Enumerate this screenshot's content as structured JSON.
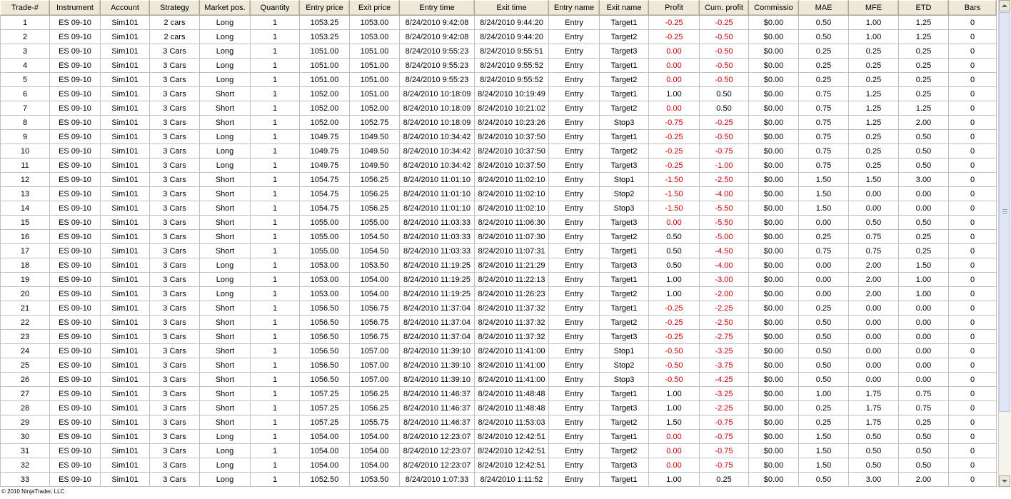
{
  "columns": [
    "Trade-#",
    "Instrument",
    "Account",
    "Strategy",
    "Market pos.",
    "Quantity",
    "Entry price",
    "Exit price",
    "Entry time",
    "Exit time",
    "Entry name",
    "Exit name",
    "Profit",
    "Cum. profit",
    "Commissio",
    "MAE",
    "MFE",
    "ETD",
    "Bars"
  ],
  "colors": {
    "negative": "#cc0000",
    "header_bg": "#ece9d8"
  },
  "rows": [
    [
      "1",
      "ES 09-10",
      "Sim101",
      "2 cars",
      "Long",
      "1",
      "1053.25",
      "1053.00",
      "8/24/2010 9:42:08",
      "8/24/2010 9:44:20",
      "Entry",
      "Target1",
      "-0.25",
      "-0.25",
      "$0.00",
      "0.50",
      "1.00",
      "1.25",
      "0"
    ],
    [
      "2",
      "ES 09-10",
      "Sim101",
      "2 cars",
      "Long",
      "1",
      "1053.25",
      "1053.00",
      "8/24/2010 9:42:08",
      "8/24/2010 9:44:20",
      "Entry",
      "Target2",
      "-0.25",
      "-0.50",
      "$0.00",
      "0.50",
      "1.00",
      "1.25",
      "0"
    ],
    [
      "3",
      "ES 09-10",
      "Sim101",
      "3 Cars",
      "Long",
      "1",
      "1051.00",
      "1051.00",
      "8/24/2010 9:55:23",
      "8/24/2010 9:55:51",
      "Entry",
      "Target3",
      "0.00",
      "-0.50",
      "$0.00",
      "0.25",
      "0.25",
      "0.25",
      "0"
    ],
    [
      "4",
      "ES 09-10",
      "Sim101",
      "3 Cars",
      "Long",
      "1",
      "1051.00",
      "1051.00",
      "8/24/2010 9:55:23",
      "8/24/2010 9:55:52",
      "Entry",
      "Target1",
      "0.00",
      "-0.50",
      "$0.00",
      "0.25",
      "0.25",
      "0.25",
      "0"
    ],
    [
      "5",
      "ES 09-10",
      "Sim101",
      "3 Cars",
      "Long",
      "1",
      "1051.00",
      "1051.00",
      "8/24/2010 9:55:23",
      "8/24/2010 9:55:52",
      "Entry",
      "Target2",
      "0.00",
      "-0.50",
      "$0.00",
      "0.25",
      "0.25",
      "0.25",
      "0"
    ],
    [
      "6",
      "ES 09-10",
      "Sim101",
      "3 Cars",
      "Short",
      "1",
      "1052.00",
      "1051.00",
      "8/24/2010 10:18:09",
      "8/24/2010 10:19:49",
      "Entry",
      "Target1",
      "1.00",
      "0.50",
      "$0.00",
      "0.75",
      "1.25",
      "0.25",
      "0"
    ],
    [
      "7",
      "ES 09-10",
      "Sim101",
      "3 Cars",
      "Short",
      "1",
      "1052.00",
      "1052.00",
      "8/24/2010 10:18:09",
      "8/24/2010 10:21:02",
      "Entry",
      "Target2",
      "0.00",
      "0.50",
      "$0.00",
      "0.75",
      "1.25",
      "1.25",
      "0"
    ],
    [
      "8",
      "ES 09-10",
      "Sim101",
      "3 Cars",
      "Short",
      "1",
      "1052.00",
      "1052.75",
      "8/24/2010 10:18:09",
      "8/24/2010 10:23:26",
      "Entry",
      "Stop3",
      "-0.75",
      "-0.25",
      "$0.00",
      "0.75",
      "1.25",
      "2.00",
      "0"
    ],
    [
      "9",
      "ES 09-10",
      "Sim101",
      "3 Cars",
      "Long",
      "1",
      "1049.75",
      "1049.50",
      "8/24/2010 10:34:42",
      "8/24/2010 10:37:50",
      "Entry",
      "Target1",
      "-0.25",
      "-0.50",
      "$0.00",
      "0.75",
      "0.25",
      "0.50",
      "0"
    ],
    [
      "10",
      "ES 09-10",
      "Sim101",
      "3 Cars",
      "Long",
      "1",
      "1049.75",
      "1049.50",
      "8/24/2010 10:34:42",
      "8/24/2010 10:37:50",
      "Entry",
      "Target2",
      "-0.25",
      "-0.75",
      "$0.00",
      "0.75",
      "0.25",
      "0.50",
      "0"
    ],
    [
      "11",
      "ES 09-10",
      "Sim101",
      "3 Cars",
      "Long",
      "1",
      "1049.75",
      "1049.50",
      "8/24/2010 10:34:42",
      "8/24/2010 10:37:50",
      "Entry",
      "Target3",
      "-0.25",
      "-1.00",
      "$0.00",
      "0.75",
      "0.25",
      "0.50",
      "0"
    ],
    [
      "12",
      "ES 09-10",
      "Sim101",
      "3 Cars",
      "Short",
      "1",
      "1054.75",
      "1056.25",
      "8/24/2010 11:01:10",
      "8/24/2010 11:02:10",
      "Entry",
      "Stop1",
      "-1.50",
      "-2.50",
      "$0.00",
      "1.50",
      "1.50",
      "3.00",
      "0"
    ],
    [
      "13",
      "ES 09-10",
      "Sim101",
      "3 Cars",
      "Short",
      "1",
      "1054.75",
      "1056.25",
      "8/24/2010 11:01:10",
      "8/24/2010 11:02:10",
      "Entry",
      "Stop2",
      "-1.50",
      "-4.00",
      "$0.00",
      "1.50",
      "0.00",
      "0.00",
      "0"
    ],
    [
      "14",
      "ES 09-10",
      "Sim101",
      "3 Cars",
      "Short",
      "1",
      "1054.75",
      "1056.25",
      "8/24/2010 11:01:10",
      "8/24/2010 11:02:10",
      "Entry",
      "Stop3",
      "-1.50",
      "-5.50",
      "$0.00",
      "1.50",
      "0.00",
      "0.00",
      "0"
    ],
    [
      "15",
      "ES 09-10",
      "Sim101",
      "3 Cars",
      "Short",
      "1",
      "1055.00",
      "1055.00",
      "8/24/2010 11:03:33",
      "8/24/2010 11:06:30",
      "Entry",
      "Target3",
      "0.00",
      "-5.50",
      "$0.00",
      "0.00",
      "0.50",
      "0.50",
      "0"
    ],
    [
      "16",
      "ES 09-10",
      "Sim101",
      "3 Cars",
      "Short",
      "1",
      "1055.00",
      "1054.50",
      "8/24/2010 11:03:33",
      "8/24/2010 11:07:30",
      "Entry",
      "Target2",
      "0.50",
      "-5.00",
      "$0.00",
      "0.25",
      "0.75",
      "0.25",
      "0"
    ],
    [
      "17",
      "ES 09-10",
      "Sim101",
      "3 Cars",
      "Short",
      "1",
      "1055.00",
      "1054.50",
      "8/24/2010 11:03:33",
      "8/24/2010 11:07:31",
      "Entry",
      "Target1",
      "0.50",
      "-4.50",
      "$0.00",
      "0.75",
      "0.75",
      "0.25",
      "0"
    ],
    [
      "18",
      "ES 09-10",
      "Sim101",
      "3 Cars",
      "Long",
      "1",
      "1053.00",
      "1053.50",
      "8/24/2010 11:19:25",
      "8/24/2010 11:21:29",
      "Entry",
      "Target3",
      "0.50",
      "-4.00",
      "$0.00",
      "0.00",
      "2.00",
      "1.50",
      "0"
    ],
    [
      "19",
      "ES 09-10",
      "Sim101",
      "3 Cars",
      "Long",
      "1",
      "1053.00",
      "1054.00",
      "8/24/2010 11:19:25",
      "8/24/2010 11:22:13",
      "Entry",
      "Target1",
      "1.00",
      "-3.00",
      "$0.00",
      "0.00",
      "2.00",
      "1.00",
      "0"
    ],
    [
      "20",
      "ES 09-10",
      "Sim101",
      "3 Cars",
      "Long",
      "1",
      "1053.00",
      "1054.00",
      "8/24/2010 11:19:25",
      "8/24/2010 11:26:23",
      "Entry",
      "Target2",
      "1.00",
      "-2.00",
      "$0.00",
      "0.00",
      "2.00",
      "1.00",
      "0"
    ],
    [
      "21",
      "ES 09-10",
      "Sim101",
      "3 Cars",
      "Short",
      "1",
      "1056.50",
      "1056.75",
      "8/24/2010 11:37:04",
      "8/24/2010 11:37:32",
      "Entry",
      "Target1",
      "-0.25",
      "-2.25",
      "$0.00",
      "0.25",
      "0.00",
      "0.00",
      "0"
    ],
    [
      "22",
      "ES 09-10",
      "Sim101",
      "3 Cars",
      "Short",
      "1",
      "1056.50",
      "1056.75",
      "8/24/2010 11:37:04",
      "8/24/2010 11:37:32",
      "Entry",
      "Target2",
      "-0.25",
      "-2.50",
      "$0.00",
      "0.50",
      "0.00",
      "0.00",
      "0"
    ],
    [
      "23",
      "ES 09-10",
      "Sim101",
      "3 Cars",
      "Short",
      "1",
      "1056.50",
      "1056.75",
      "8/24/2010 11:37:04",
      "8/24/2010 11:37:32",
      "Entry",
      "Target3",
      "-0.25",
      "-2.75",
      "$0.00",
      "0.50",
      "0.00",
      "0.00",
      "0"
    ],
    [
      "24",
      "ES 09-10",
      "Sim101",
      "3 Cars",
      "Short",
      "1",
      "1056.50",
      "1057.00",
      "8/24/2010 11:39:10",
      "8/24/2010 11:41:00",
      "Entry",
      "Stop1",
      "-0.50",
      "-3.25",
      "$0.00",
      "0.50",
      "0.00",
      "0.00",
      "0"
    ],
    [
      "25",
      "ES 09-10",
      "Sim101",
      "3 Cars",
      "Short",
      "1",
      "1056.50",
      "1057.00",
      "8/24/2010 11:39:10",
      "8/24/2010 11:41:00",
      "Entry",
      "Stop2",
      "-0.50",
      "-3.75",
      "$0.00",
      "0.50",
      "0.00",
      "0.00",
      "0"
    ],
    [
      "26",
      "ES 09-10",
      "Sim101",
      "3 Cars",
      "Short",
      "1",
      "1056.50",
      "1057.00",
      "8/24/2010 11:39:10",
      "8/24/2010 11:41:00",
      "Entry",
      "Stop3",
      "-0.50",
      "-4.25",
      "$0.00",
      "0.50",
      "0.00",
      "0.00",
      "0"
    ],
    [
      "27",
      "ES 09-10",
      "Sim101",
      "3 Cars",
      "Short",
      "1",
      "1057.25",
      "1056.25",
      "8/24/2010 11:46:37",
      "8/24/2010 11:48:48",
      "Entry",
      "Target1",
      "1.00",
      "-3.25",
      "$0.00",
      "1.00",
      "1.75",
      "0.75",
      "0"
    ],
    [
      "28",
      "ES 09-10",
      "Sim101",
      "3 Cars",
      "Short",
      "1",
      "1057.25",
      "1056.25",
      "8/24/2010 11:46:37",
      "8/24/2010 11:48:48",
      "Entry",
      "Target3",
      "1.00",
      "-2.25",
      "$0.00",
      "0.25",
      "1.75",
      "0.75",
      "0"
    ],
    [
      "29",
      "ES 09-10",
      "Sim101",
      "3 Cars",
      "Short",
      "1",
      "1057.25",
      "1055.75",
      "8/24/2010 11:46:37",
      "8/24/2010 11:53:03",
      "Entry",
      "Target2",
      "1.50",
      "-0.75",
      "$0.00",
      "0.25",
      "1.75",
      "0.25",
      "0"
    ],
    [
      "30",
      "ES 09-10",
      "Sim101",
      "3 Cars",
      "Long",
      "1",
      "1054.00",
      "1054.00",
      "8/24/2010 12:23:07",
      "8/24/2010 12:42:51",
      "Entry",
      "Target1",
      "0.00",
      "-0.75",
      "$0.00",
      "1.50",
      "0.50",
      "0.50",
      "0"
    ],
    [
      "31",
      "ES 09-10",
      "Sim101",
      "3 Cars",
      "Long",
      "1",
      "1054.00",
      "1054.00",
      "8/24/2010 12:23:07",
      "8/24/2010 12:42:51",
      "Entry",
      "Target2",
      "0.00",
      "-0.75",
      "$0.00",
      "1.50",
      "0.50",
      "0.50",
      "0"
    ],
    [
      "32",
      "ES 09-10",
      "Sim101",
      "3 Cars",
      "Long",
      "1",
      "1054.00",
      "1054.00",
      "8/24/2010 12:23:07",
      "8/24/2010 12:42:51",
      "Entry",
      "Target3",
      "0.00",
      "-0.75",
      "$0.00",
      "1.50",
      "0.50",
      "0.50",
      "0"
    ],
    [
      "33",
      "ES 09-10",
      "Sim101",
      "3 Cars",
      "Long",
      "1",
      "1052.50",
      "1053.50",
      "8/24/2010 1:07:33",
      "8/24/2010 1:11:52",
      "Entry",
      "Target1",
      "1.00",
      "0.25",
      "$0.00",
      "0.50",
      "3.00",
      "2.00",
      "0"
    ]
  ],
  "footer": {
    "copyright": "© 2010 NinjaTrader, LLC"
  },
  "scrollbar": {
    "up_icon": "arrow-up-icon",
    "down_icon": "arrow-down-icon"
  }
}
